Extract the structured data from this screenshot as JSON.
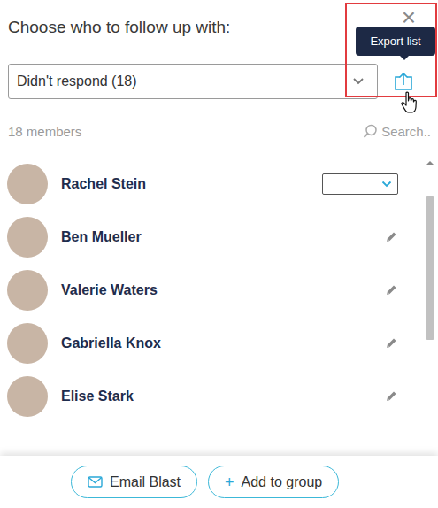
{
  "header": {
    "title": "Choose who to follow up with:",
    "close": "×"
  },
  "tooltip": {
    "label": "Export list"
  },
  "export": {
    "highlighted": true
  },
  "filter": {
    "value": "Didn't respond (18)"
  },
  "summary": {
    "count": "18 members",
    "search_placeholder": "Search.."
  },
  "members": [
    {
      "name": "Rachel Stein",
      "kind": "select"
    },
    {
      "name": "Ben Mueller",
      "kind": "edit"
    },
    {
      "name": "Valerie Waters",
      "kind": "edit"
    },
    {
      "name": "Gabriella Knox",
      "kind": "edit"
    },
    {
      "name": "Elise Stark",
      "kind": "edit"
    }
  ],
  "buttons": [
    {
      "label": "Email Blast",
      "kind": "mail",
      "icon": ""
    },
    {
      "label": "Add to group",
      "kind": "plus",
      "icon": "+"
    }
  ]
}
